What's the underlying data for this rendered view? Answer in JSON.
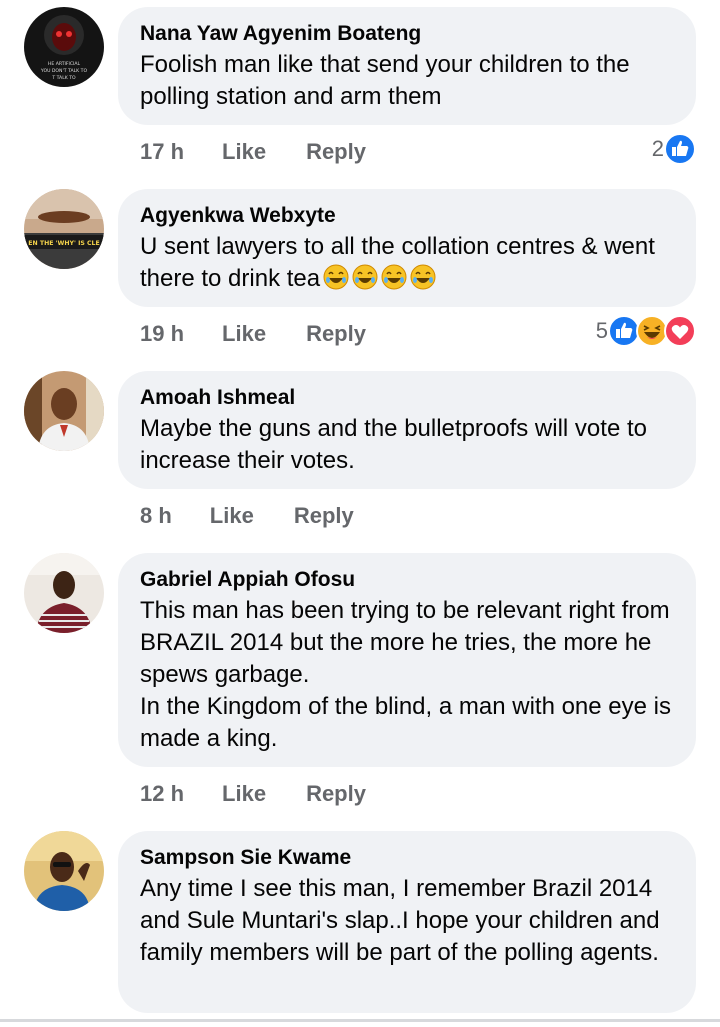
{
  "comments": [
    {
      "author": "Nana Yaw Agyenim Boateng",
      "text": "Foolish man like that send your children to the polling station and arm them",
      "time": "17 h",
      "like_label": "Like",
      "reply_label": "Reply",
      "reaction_count": "2",
      "reactions": [
        "like-icon"
      ]
    },
    {
      "author": "Agyenkwa Webxyte",
      "text": "U sent lawyers to all the collation centres & went there to drink tea",
      "emojis": [
        "laughing-emoji",
        "laughing-emoji",
        "laughing-emoji",
        "laughing-emoji"
      ],
      "time": "19 h",
      "like_label": "Like",
      "reply_label": "Reply",
      "reaction_count": "5",
      "reactions": [
        "like-icon",
        "haha-icon",
        "love-icon"
      ]
    },
    {
      "author": "Amoah Ishmeal",
      "text": "Maybe the guns and the bulletproofs will vote to increase their votes.",
      "time": "8 h",
      "like_label": "Like",
      "reply_label": "Reply"
    },
    {
      "author": "Gabriel Appiah Ofosu",
      "text": "This man has been trying to be relevant right from BRAZIL 2014 but the more he tries, the more he spews garbage.\nIn the Kingdom of the blind, a man with one eye is made a king.",
      "time": "12 h",
      "like_label": "Like",
      "reply_label": "Reply"
    },
    {
      "author": "Sampson Sie Kwame",
      "text": "Any time I see this man, I remember Brazil 2014 and Sule Muntari's slap..I hope your children and family members will be part of the polling agents."
    }
  ],
  "avatar_texts": {
    "nana": [
      "HE ARTIFICIAL",
      "YOU DON'T TALK TO",
      "T TALK TO"
    ],
    "agyenkwa": "EN THE 'WHY' IS CLE"
  },
  "colors": {
    "bubble": "#f0f2f5",
    "like_blue": "#1877f2",
    "love_red": "#f33e58",
    "haha_yellow": "#f7b125",
    "meta_gray": "#65676b"
  }
}
